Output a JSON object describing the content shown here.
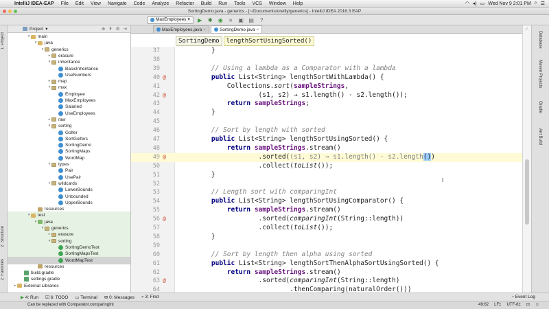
{
  "menubar": {
    "app_name": "IntelliJ IDEA-EAP",
    "items": [
      "File",
      "Edit",
      "View",
      "Navigate",
      "Code",
      "Analyze",
      "Refactor",
      "Build",
      "Run",
      "Tools",
      "VCS",
      "Window",
      "Help"
    ],
    "clock": "Wed Nov 9  2:01 PM"
  },
  "window": {
    "title": "SortingDemo.java - generics - [~/Documents/oreilly/generics] - IntelliJ IDEA 2016.3 EAP"
  },
  "toolbar": {
    "run_config": "MaxEmployees"
  },
  "project": {
    "header": "Project",
    "rows": [
      {
        "label": "main",
        "indent": 2,
        "type": "folder",
        "arrow": "▾"
      },
      {
        "label": "java",
        "indent": 3,
        "type": "folder",
        "arrow": "▾"
      },
      {
        "label": "generics",
        "indent": 4,
        "type": "pkg",
        "arrow": "▾"
      },
      {
        "label": "erasure",
        "indent": 5,
        "type": "pkg",
        "arrow": "▸"
      },
      {
        "label": "inheritance",
        "indent": 5,
        "type": "pkg",
        "arrow": "▾"
      },
      {
        "label": "BasicInheritance",
        "indent": 6,
        "type": "class",
        "arrow": ""
      },
      {
        "label": "UseNumbers",
        "indent": 6,
        "type": "class",
        "arrow": ""
      },
      {
        "label": "map",
        "indent": 5,
        "type": "pkg",
        "arrow": "▸"
      },
      {
        "label": "max",
        "indent": 5,
        "type": "pkg",
        "arrow": "▾"
      },
      {
        "label": "Employee",
        "indent": 6,
        "type": "class",
        "arrow": ""
      },
      {
        "label": "MaxEmployees",
        "indent": 6,
        "type": "class",
        "arrow": ""
      },
      {
        "label": "Salaried",
        "indent": 6,
        "type": "class",
        "arrow": ""
      },
      {
        "label": "UseEmployees",
        "indent": 6,
        "type": "class",
        "arrow": ""
      },
      {
        "label": "raw",
        "indent": 5,
        "type": "pkg",
        "arrow": "▸"
      },
      {
        "label": "sorting",
        "indent": 5,
        "type": "pkg",
        "arrow": "▾"
      },
      {
        "label": "Golfer",
        "indent": 6,
        "type": "class",
        "arrow": ""
      },
      {
        "label": "SortGolfers",
        "indent": 6,
        "type": "class",
        "arrow": ""
      },
      {
        "label": "SortingDemo",
        "indent": 6,
        "type": "class",
        "arrow": ""
      },
      {
        "label": "SortingMaps",
        "indent": 6,
        "type": "class",
        "arrow": ""
      },
      {
        "label": "WordMap",
        "indent": 6,
        "type": "class",
        "arrow": ""
      },
      {
        "label": "types",
        "indent": 5,
        "type": "pkg",
        "arrow": "▾"
      },
      {
        "label": "Pair",
        "indent": 6,
        "type": "class",
        "arrow": ""
      },
      {
        "label": "UsePair",
        "indent": 6,
        "type": "class",
        "arrow": ""
      },
      {
        "label": "wildcards",
        "indent": 5,
        "type": "pkg",
        "arrow": "▾"
      },
      {
        "label": "LowerBounds",
        "indent": 6,
        "type": "class",
        "arrow": ""
      },
      {
        "label": "Unbounded",
        "indent": 6,
        "type": "class",
        "arrow": ""
      },
      {
        "label": "UpperBounds",
        "indent": 6,
        "type": "class",
        "arrow": ""
      },
      {
        "label": "resources",
        "indent": 3,
        "type": "res",
        "arrow": ""
      },
      {
        "label": "test",
        "indent": 2,
        "type": "folder",
        "arrow": "▾",
        "test": true
      },
      {
        "label": "java",
        "indent": 3,
        "type": "green",
        "arrow": "▾",
        "test": true
      },
      {
        "label": "generics",
        "indent": 4,
        "type": "pkg",
        "arrow": "▾",
        "test": true
      },
      {
        "label": "erasure",
        "indent": 5,
        "type": "pkg",
        "arrow": "▸",
        "test": true
      },
      {
        "label": "sorting",
        "indent": 5,
        "type": "pkg",
        "arrow": "▾",
        "test": true
      },
      {
        "label": "SortingDemoTest",
        "indent": 6,
        "type": "test",
        "arrow": "",
        "test": true
      },
      {
        "label": "SortingMapsTest",
        "indent": 6,
        "type": "test",
        "arrow": "",
        "test": true
      },
      {
        "label": "WordMapTest",
        "indent": 6,
        "type": "test",
        "arrow": "",
        "test": true,
        "selected": true
      },
      {
        "label": "resources",
        "indent": 3,
        "type": "res",
        "arrow": ""
      },
      {
        "label": "build.gradle",
        "indent": 1,
        "type": "gradle",
        "arrow": ""
      },
      {
        "label": "settings.gradle",
        "indent": 1,
        "type": "gradle",
        "arrow": ""
      },
      {
        "label": "External Libraries",
        "indent": 0,
        "type": "folder",
        "arrow": "▸"
      }
    ]
  },
  "tabs": [
    {
      "label": "MaxEmployees.java",
      "active": false
    },
    {
      "label": "SortingDemo.java",
      "active": true
    }
  ],
  "breadcrumb": [
    "SortingDemo",
    "lengthSortUsingSorted()"
  ],
  "code_lines": [
    {
      "n": "37",
      "html": "    }"
    },
    {
      "n": "38",
      "html": ""
    },
    {
      "n": "39",
      "html": "    <span class='cm'>// Using a lambda as a Comparator with a lambda</span>"
    },
    {
      "n": "40",
      "html": "    <span class='kw'>public</span> List&lt;String&gt; lengthSortWithLambda() {",
      "mark": "@"
    },
    {
      "n": "41",
      "html": "        Collections.<span class='sm'>sort</span>(<span class='fld'>sampleStrings</span>,"
    },
    {
      "n": "42",
      "html": "                (s1, s2) → s1.length() - s2.length());",
      "mark": "@"
    },
    {
      "n": "43",
      "html": "        <span class='kw'>return</span> <span class='fld'>sampleStrings</span>;"
    },
    {
      "n": "44",
      "html": "    }"
    },
    {
      "n": "45",
      "html": ""
    },
    {
      "n": "46",
      "html": "    <span class='cm'>// Sort by length with sorted</span>"
    },
    {
      "n": "47",
      "html": "    <span class='kw'>public</span> List&lt;String&gt; lengthSortUsingSorted() {"
    },
    {
      "n": "48",
      "html": "        <span class='kw'>return</span> <span class='fld'>sampleStrings</span>.stream()"
    },
    {
      "n": "49",
      "html": "                .sorted(<span class='prm'>(s1, s2) → s1.length() - s2.length</span><span class='hl'>()</span>)",
      "mark": "@",
      "current": true
    },
    {
      "n": "50",
      "html": "                .collect(<span class='sm'>toList</span>());"
    },
    {
      "n": "51",
      "html": "    }"
    },
    {
      "n": "52",
      "html": ""
    },
    {
      "n": "53",
      "html": "    <span class='cm'>// Length sort with comparingInt</span>"
    },
    {
      "n": "54",
      "html": "    <span class='kw'>public</span> List&lt;String&gt; lengthSortUsingComparator() {"
    },
    {
      "n": "55",
      "html": "        <span class='kw'>return</span> <span class='fld'>sampleStrings</span>.stream()"
    },
    {
      "n": "56",
      "html": "                .sorted(<span class='sm'>comparingInt</span>(String::length))",
      "mark": "@"
    },
    {
      "n": "57",
      "html": "                .collect(<span class='sm'>toList</span>());"
    },
    {
      "n": "58",
      "html": "    }"
    },
    {
      "n": "59",
      "html": ""
    },
    {
      "n": "60",
      "html": "    <span class='cm'>// Sort by length then alpha using sorted</span>"
    },
    {
      "n": "61",
      "html": "    <span class='kw'>public</span> List&lt;String&gt; lengthSortThenAlphaSortUsingSorted() {"
    },
    {
      "n": "62",
      "html": "        <span class='kw'>return</span> <span class='fld'>sampleStrings</span>.stream()"
    },
    {
      "n": "63",
      "html": "                .sorted(<span class='sm'>comparingInt</span>(String::length)",
      "mark": "@"
    },
    {
      "n": "64",
      "html": "                        .thenComparing(naturalOrder()))"
    }
  ],
  "right_tools": [
    "Database",
    "Maven Projects",
    "Gradle",
    "Ant Build"
  ],
  "left_tools": [
    "1: Project",
    "2: Structure",
    "2: Favorites"
  ],
  "bottom_tools": [
    "4: Run",
    "6: TODO",
    "Terminal",
    "0: Messages",
    "3: Find"
  ],
  "event_log": "Event Log",
  "status": {
    "message": "Can be replaced with Comparator.comparingInt",
    "position": "49:62",
    "line_sep": "LF‡",
    "encoding": "UTF-8‡"
  }
}
